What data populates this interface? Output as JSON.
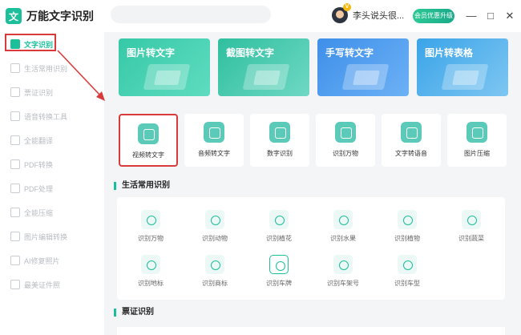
{
  "app": {
    "title": "万能文字识别",
    "logo_glyph": "文"
  },
  "user": {
    "name": "李头说头很...",
    "vip_badge": "V",
    "vip_button": "会员优惠升级"
  },
  "window": {
    "minimize": "—",
    "maximize": "□",
    "close": "✕"
  },
  "colors": {
    "accent": "#1bbf9a",
    "highlight_red": "#d93b3b"
  },
  "sidebar": {
    "items": [
      {
        "label": "文字识别",
        "active": true
      },
      {
        "label": "生活常用识别"
      },
      {
        "label": "票证识别"
      },
      {
        "label": "语音转换工具"
      },
      {
        "label": "全能翻译"
      },
      {
        "label": "PDF转换"
      },
      {
        "label": "PDF处理"
      },
      {
        "label": "全能压缩"
      },
      {
        "label": "图片编辑转换"
      },
      {
        "label": "AI修复照片"
      },
      {
        "label": "最美证件照"
      }
    ]
  },
  "banners": [
    {
      "label": "图片转文字",
      "color_from": "#36c9a7",
      "color_to": "#5fdcc0"
    },
    {
      "label": "截图转文字",
      "color_from": "#2fbf9f",
      "color_to": "#6fd8c4"
    },
    {
      "label": "手写转文字",
      "color_from": "#3e8fea",
      "color_to": "#6cb1f5"
    },
    {
      "label": "图片转表格",
      "color_from": "#3aa4e8",
      "color_to": "#7ec6f2"
    }
  ],
  "tools": [
    {
      "label": "视频转文字",
      "highlighted": true
    },
    {
      "label": "音频转文字"
    },
    {
      "label": "数字识别"
    },
    {
      "label": "识别万物"
    },
    {
      "label": "文字转语音"
    },
    {
      "label": "图片压缩"
    }
  ],
  "sections": {
    "life": "生活常用识别",
    "tickets": "票证识别"
  },
  "life_items": [
    {
      "label": "识别万物"
    },
    {
      "label": "识别动物"
    },
    {
      "label": "识别植花"
    },
    {
      "label": "识别水果"
    },
    {
      "label": "识别植物"
    },
    {
      "label": "识别蔬菜"
    },
    {
      "label": "识别地标"
    },
    {
      "label": "识别商标"
    },
    {
      "label": "识别车牌",
      "selected": true
    },
    {
      "label": "识别车架号"
    },
    {
      "label": "识别车型"
    }
  ]
}
